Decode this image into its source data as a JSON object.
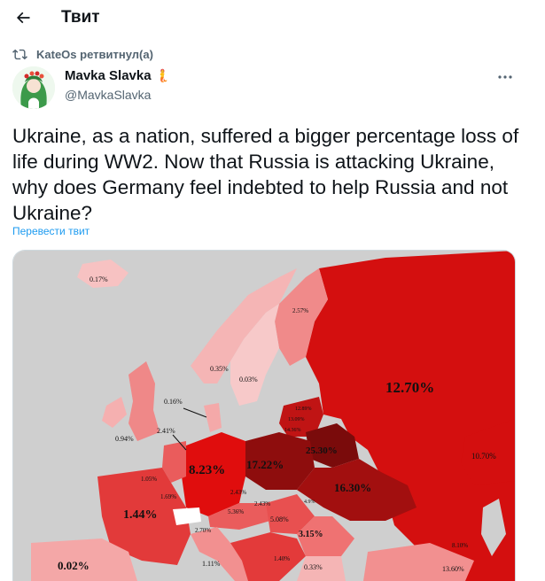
{
  "header": {
    "title": "Твит",
    "back_icon": "arrow-left-icon"
  },
  "retweet": {
    "text": "KateOs ретвитнул(а)",
    "icon": "retweet-icon"
  },
  "author": {
    "name": "Mavka Slavka",
    "emoji": "🧜",
    "handle": "@MavkaSlavka"
  },
  "tweet": {
    "text": "Ukraine, as a nation, suffered a bigger percentage loss of life during WW2. Now that Russia is attacking Ukraine, why does Germany feel indebted to help Russia and not Ukraine?",
    "translate_label": "Перевести твит"
  },
  "map": {
    "labels": {
      "russia": "12.70%",
      "germany": "8.23%",
      "poland": "17.22%",
      "belarus": "25.30%",
      "ukraine": "16.30%",
      "france": "1.44%",
      "spain": "0.02%",
      "iceland": "0.17%",
      "norway": "0.35%",
      "sweden": "0.03%",
      "finland": "2.57%",
      "denmark": "0.16%",
      "uk": "0.94%",
      "netherlands": "2.41%",
      "belgium": "1.05%",
      "luxembourg": "1.69%",
      "czech": "2.43%",
      "austria": "5.36%",
      "hungary": "5.08%",
      "slovakia": "2.43%",
      "romania": "3.15%",
      "italy": "1.11%",
      "switzerland": "2.70%",
      "yugoslavia": "1.40%",
      "bulgaria": "0.33%",
      "lithuania": "14.36%",
      "latvia": "13.09%",
      "estonia": "12.89%",
      "kazakh": "10.70%",
      "turkey": "13.60%",
      "moldova": "4.9%",
      "georgia": "8.10%"
    },
    "colors": {
      "sea": "#d4d4d4",
      "ocean": "#c9c9c9",
      "darkest": "#7a0b0b",
      "dark": "#a80f0f",
      "red": "#d21c1c",
      "mid": "#e95353",
      "light": "#f3a0a0",
      "pale": "#f7c4c4",
      "neutral": "#ffffff"
    }
  },
  "colors": {
    "accent": "#1d9bf0",
    "secondary_text": "#536471"
  }
}
